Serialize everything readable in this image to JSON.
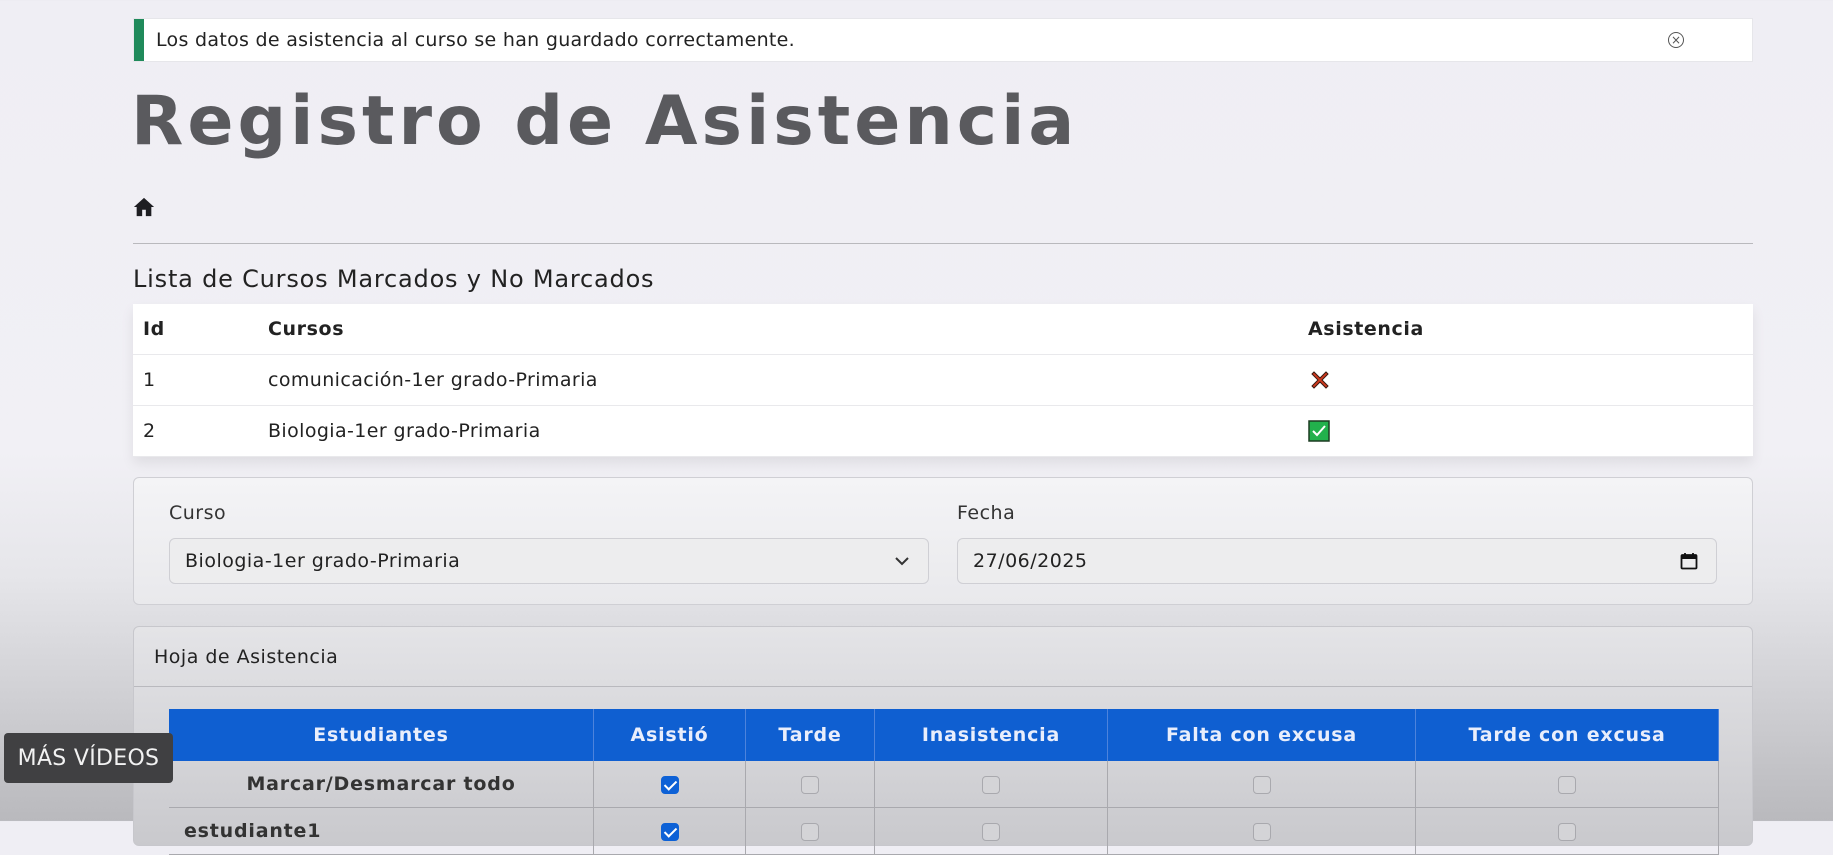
{
  "alert": {
    "message": "Los datos de asistencia al curso se han guardado correctamente.",
    "close_icon": "close-circle-icon",
    "accent": "#1f8a5b"
  },
  "page": {
    "title": "Registro de Asistencia",
    "home_icon": "home-icon"
  },
  "courses": {
    "heading": "Lista de Cursos Marcados y No Marcados",
    "columns": [
      "Id",
      "Cursos",
      "Asistencia"
    ],
    "rows": [
      {
        "id": "1",
        "course": "comunicación-1er grado-Primaria",
        "status_icon": "cross-mark-icon"
      },
      {
        "id": "2",
        "course": "Biologia-1er grado-Primaria",
        "status_icon": "check-box-icon"
      }
    ]
  },
  "filters": {
    "course_label": "Curso",
    "course_value": "Biologia-1er grado-Primaria",
    "date_label": "Fecha",
    "date_value": "27/06/2025"
  },
  "sheet": {
    "title": "Hoja de Asistencia",
    "columns": [
      "Estudiantes",
      "Asistió",
      "Tarde",
      "Inasistencia",
      "Falta con excusa",
      "Tarde con excusa"
    ],
    "rows": [
      {
        "name": "Marcar/Desmarcar todo",
        "checks": [
          true,
          false,
          false,
          false,
          false
        ]
      },
      {
        "name": "estudiante1",
        "checks": [
          true,
          false,
          false,
          false,
          false
        ]
      }
    ],
    "header_color": "#0f5fd1"
  },
  "overlay": {
    "more_videos": "MÁS VÍDEOS"
  }
}
